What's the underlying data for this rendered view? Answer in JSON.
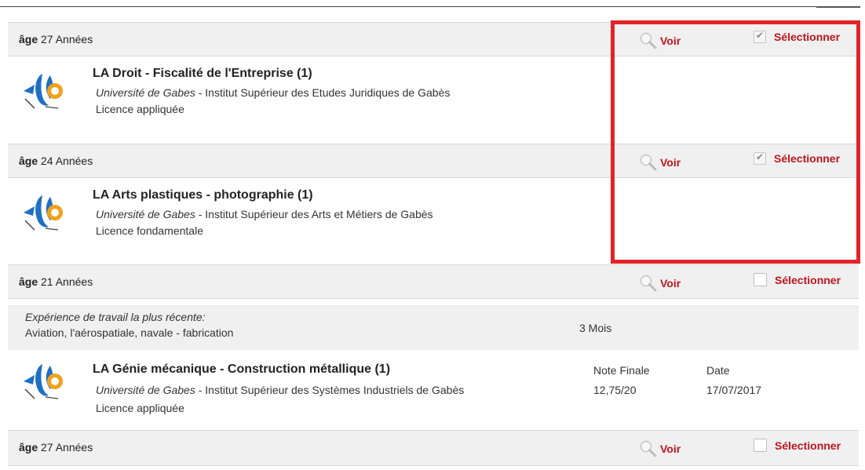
{
  "voir_label": "Voir",
  "selectionner_label": "Sélectionner",
  "age_prefix": "âge",
  "rows": [
    {
      "age_text": "27 Années",
      "selected": true,
      "title": "LA Droit - Fiscalité de l'Entreprise (1)",
      "university": "Université de Gabes",
      "institute": " - Institut Supérieur des Etudes Juridiques de Gabès",
      "degree": "Licence appliquée"
    },
    {
      "age_text": "24 Années",
      "selected": true,
      "title": "LA Arts plastiques - photographie (1)",
      "university": "Université de Gabes",
      "institute": " - Institut Supérieur des Arts et Métiers de Gabès",
      "degree": "Licence fondamentale"
    },
    {
      "age_text": "21 Années",
      "selected": false,
      "experience_label": "Expérience de travail la plus récente:",
      "experience_value": "Aviation, l'aérospatiale, navale - fabrication",
      "experience_duration": "3 Mois",
      "title": "LA Génie mécanique - Construction métallique (1)",
      "university": "Université de Gabes",
      "institute": " - Institut Supérieur des Systèmes Industriels de Gabès",
      "degree": "Licence appliquée",
      "note_finale_label": "Note Finale",
      "note_finale_value": "12,75/20",
      "date_label": "Date",
      "date_value": "17/07/2017"
    },
    {
      "age_text": "27 Années",
      "selected": false
    }
  ],
  "colors": {
    "accent_red": "#c0141c",
    "highlight_red": "#e2232a",
    "bar_bg": "#f0f0f0"
  }
}
